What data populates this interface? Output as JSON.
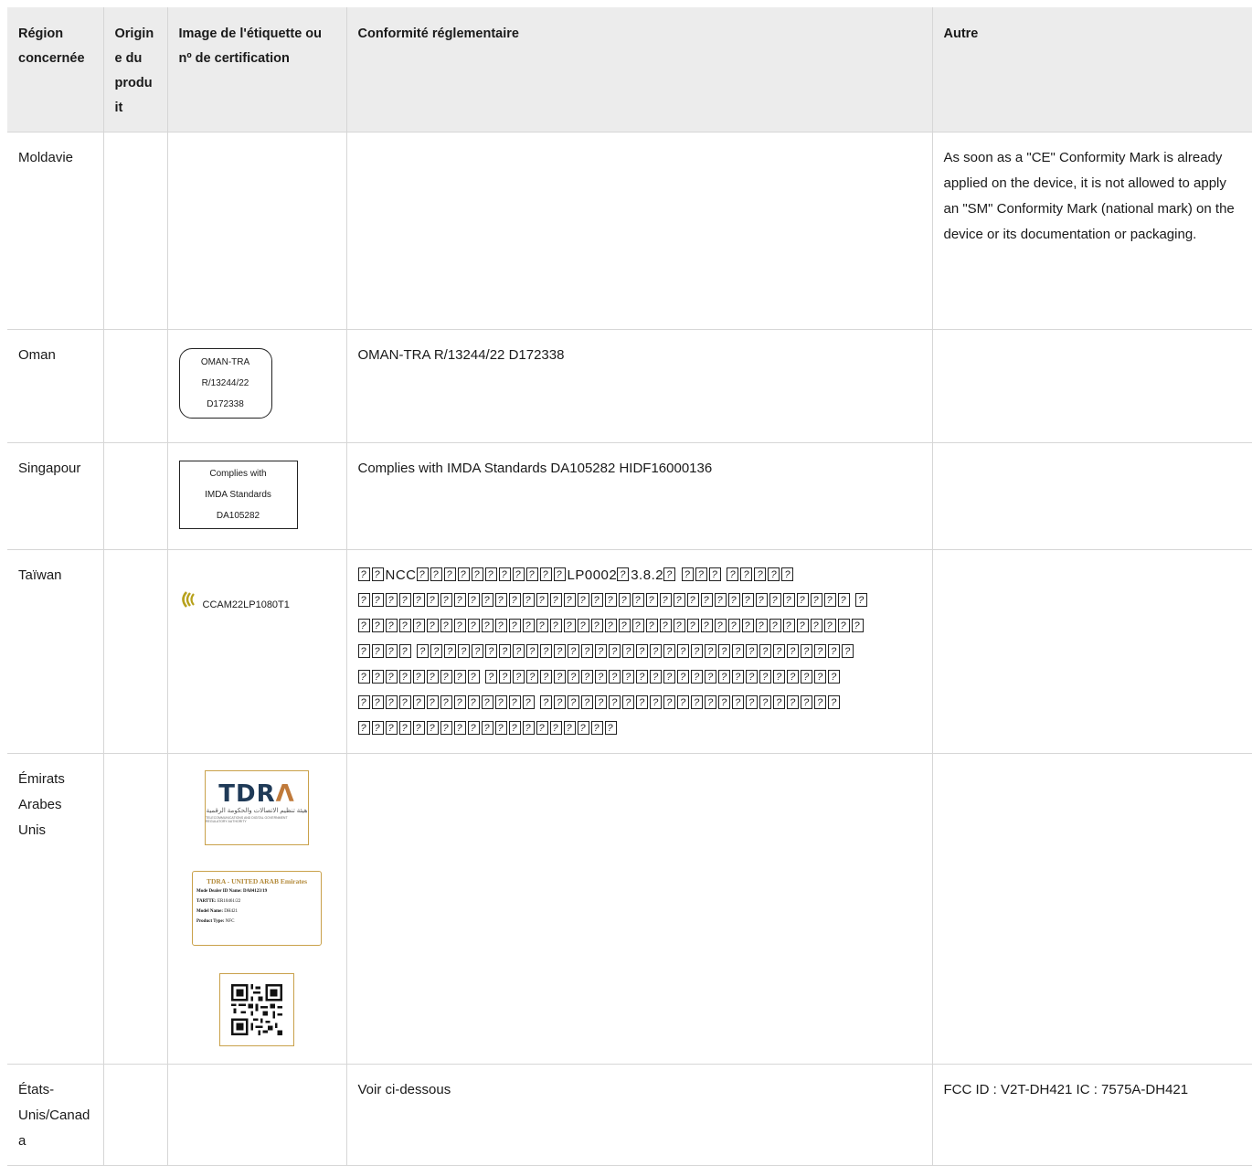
{
  "headers": {
    "region": "Région concernée",
    "origin": "Origine du produit",
    "label": "Image de l'étiquette ou nº de certification",
    "conformity": "Conformité réglementaire",
    "other": "Autre"
  },
  "rows": {
    "moldova": {
      "region": "Moldavie",
      "other": "As soon as a \"CE\" Conformity Mark is already applied on the device, it is not allowed to apply an \"SM\" Conformity Mark (national mark) on the device or its documentation or packaging."
    },
    "oman": {
      "region": "Oman",
      "label_lines": [
        "OMAN-TRA",
        "R/13244/22",
        "D172338"
      ],
      "conformity": "OMAN-TRA R/13244/22 D172338"
    },
    "singapore": {
      "region": "Singapour",
      "label_lines": [
        "Complies with",
        "IMDA Standards",
        "DA105282"
      ],
      "conformity": "Complies with IMDA Standards DA105282 HIDF16000136"
    },
    "taiwan": {
      "region": "Taïwan",
      "label_text": "CCAM22LP1080T1",
      "conformity_segments": [
        "NCC",
        "LP0002",
        "3.8.2"
      ]
    },
    "uae": {
      "region": "Émirats Arabes Unis",
      "logo_text": "TDRA",
      "logo_arabic": "هيئة تنظيم الاتصالات والحكومة الرقمية",
      "logo_english": "TELECOMMUNICATIONS AND DIGITAL GOVERNMENT REGULATORY AUTHORITY",
      "card": {
        "title": "TDRA - UNITED ARAB Emirates",
        "dealer_label": "Mode Dealer ID Name:",
        "dealer_value": "DA84123/19",
        "tartte_label": "TARTTE:",
        "tartte_value": "ER10461/22",
        "model_label": "Model Name:",
        "model_value": "DH421",
        "type_label": "Product Type:",
        "type_value": "NFC"
      }
    },
    "usa": {
      "region": "États-Unis/Canada",
      "conformity": "Voir ci-dessous",
      "other": "FCC ID : V2T-DH421 IC : 7575A-DH421"
    }
  },
  "colors": {
    "header_bg": "#ececec",
    "border": "#d6d6d6",
    "tdra_gold": "#c9a14a",
    "tdra_navy": "#1f3a57"
  }
}
